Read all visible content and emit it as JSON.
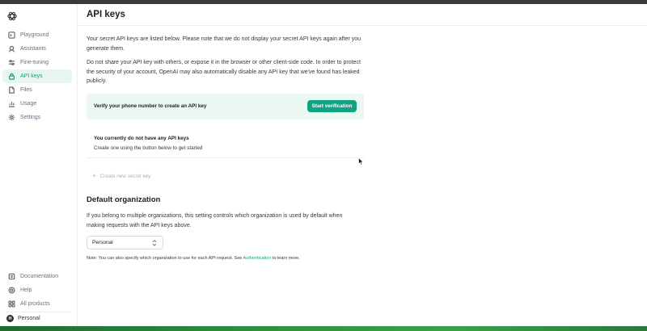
{
  "sidebar": {
    "items": [
      {
        "label": "Playground",
        "icon": "playground-icon"
      },
      {
        "label": "Assistants",
        "icon": "assistants-icon"
      },
      {
        "label": "Fine-tuning",
        "icon": "fine-tuning-icon"
      },
      {
        "label": "API keys",
        "icon": "lock-icon",
        "active": true
      },
      {
        "label": "Files",
        "icon": "file-icon"
      },
      {
        "label": "Usage",
        "icon": "usage-icon"
      },
      {
        "label": "Settings",
        "icon": "gear-icon"
      }
    ],
    "bottom_items": [
      {
        "label": "Documentation",
        "icon": "book-icon"
      },
      {
        "label": "Help",
        "icon": "help-icon"
      },
      {
        "label": "All products",
        "icon": "grid-icon"
      }
    ],
    "account": {
      "initial": "H",
      "name": "Personal"
    }
  },
  "page": {
    "title": "API keys",
    "intro": "Your secret API keys are listed below. Please note that we do not display your secret API keys again after you generate them.",
    "warning": "Do not share your API key with others, or expose it in the browser or other client-side code. In order to protect the security of your account, OpenAI may also automatically disable any API key that we've found has leaked publicly.",
    "verify": {
      "text": "Verify your phone number to create an API key",
      "button": "Start verification"
    },
    "empty": {
      "title": "You currently do not have any API keys",
      "subtitle": "Create one using the button below to get started"
    },
    "create_key": "Create new secret key",
    "default_org": {
      "title": "Default organization",
      "description": "If you belong to multiple organizations, this setting controls which organization is used by default when making requests with the API keys above.",
      "selected": "Personal",
      "note_prefix": "Note: You can also specify which organization to use for each API request. See ",
      "note_link": "Authentication",
      "note_suffix": " to learn more."
    }
  },
  "colors": {
    "accent": "#10a37f",
    "active_bg": "#e9f6ef",
    "verify_bg": "#ecf7f1"
  }
}
